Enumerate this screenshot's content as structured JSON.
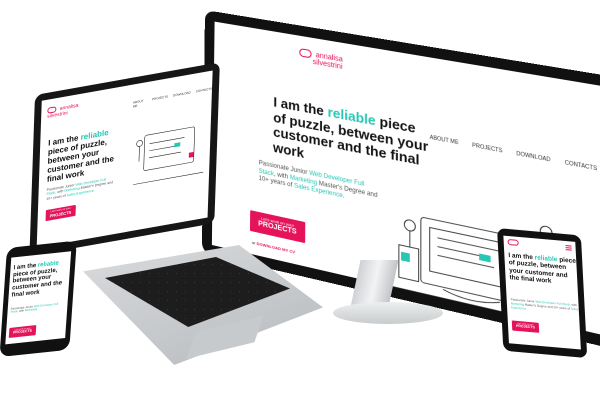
{
  "site": {
    "logo_line1": "annalisa",
    "logo_line2": "silvestrini",
    "nav": [
      "ABOUT ME",
      "PROJECTS",
      "DOWNLOAD",
      "CONTACTS"
    ],
    "headline_prefix": "I am the ",
    "headline_accent": "reliable",
    "headline_suffix": " piece of puzzle, between your customer and the final work",
    "sub_prefix": "Passionate Junior ",
    "sub_hl1": "Web Developer Full Stack",
    "sub_mid": ", with ",
    "sub_hl2": "Marketing",
    "sub_mid2": " Master's Degree and 10+ years of ",
    "sub_hl3": "Sales Experience",
    "sub_end": ".",
    "cta_small": "Let's work on your",
    "cta_big": "PROJECTS",
    "download_prefix": "or ",
    "download_link": "DOWNLOAD MY CV"
  },
  "colors": {
    "accent": "#28c7b4",
    "brand": "#e5135a",
    "bezel": "#111111"
  },
  "icons": {
    "menu": "hamburger-menu-icon",
    "logo": "logo-mark-icon"
  }
}
